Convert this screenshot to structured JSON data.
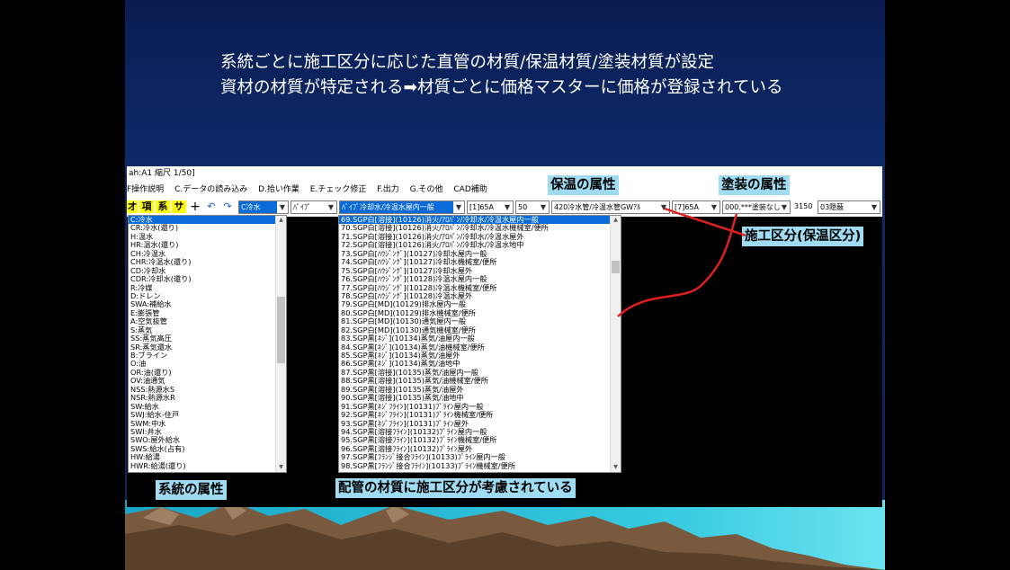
{
  "slide": {
    "title_line1": "系統ごとに施工区分に応じた直管の材質/保温材質/塗装材質が設定",
    "title_line2": "資材の材質が特定される➡材質ごとに価格マスターに価格が登録されている"
  },
  "window": {
    "title": "ah:A1 縮尺 1/50]",
    "menus": [
      "F操作説明",
      "C.データの読み込み",
      "D.拾い作業",
      "E.チェック修正",
      "F.出力",
      "G.その他",
      "CAD補助"
    ]
  },
  "toolbar": {
    "btn_zai": "オ",
    "btn_kou": "項",
    "btn_kei": "系",
    "btn_sa": "サ",
    "btn_plus": "+",
    "btn_undo": "↶",
    "btn_redo": "↷",
    "combo_system": "C冷水",
    "combo_type": "ﾊﾟｲﾌﾟ",
    "combo_material": "ﾊﾟｲﾌﾟ冷却水/冷温水屋内一般",
    "combo_size": "[1]65A",
    "combo_num": "50",
    "combo_insulation": "420冷水管/冷温水管GWｱﾙ",
    "combo_size2": "[7]65A",
    "combo_paint": "000.***塗装なし",
    "price": "3150",
    "combo_hidden": "03隠蔽"
  },
  "system_list": [
    "C:冷水",
    "CR:冷水(還り)",
    "H:温水",
    "HR:温水(還り)",
    "CH:冷温水",
    "CHR:冷温水(還り)",
    "CD:冷却水",
    "CDR:冷却水(還り)",
    "R:冷媒",
    "D:ドレン",
    "SWA:補給水",
    "E:膨張管",
    "A:空気抜管",
    "S:蒸気",
    "SS:蒸気高圧",
    "SR:蒸気還水",
    "B:ブライン",
    "O:油",
    "OR:油(還り)",
    "OV:油通気",
    "NSS:熱源水S",
    "NSR:熱源水R",
    "SW:給水",
    "SWJ:給水-住戸",
    "SWM:中水",
    "SWI:井水",
    "SWO:屋外給水",
    "SWS:給水(占有)",
    "HW:給湯",
    "HWR:給湯(還り)"
  ],
  "material_list": [
    "69.SGP白[溶接](10126)消火/ｱﾛﾊﾟﾝ/冷却水/冷温水屋内一般",
    "70.SGP白[溶接](10126)消火/ｱﾛﾊﾟﾝ/冷却水/冷温水機械室/便所",
    "71.SGP白[溶接](10126)消火/ｱﾛﾊﾟﾝ/冷却水/冷温水屋外",
    "72.SGP白[溶接](10126)消火/ｱﾛﾊﾟﾝ/冷却水/冷温水地中",
    "73.SGP白[ﾊｳｼﾞﾝｸﾞ](10127)冷却水屋内一般",
    "74.SGP白[ﾊｳｼﾞﾝｸﾞ](10127)冷却水機械室/便所",
    "75.SGP白[ﾊｳｼﾞﾝｸﾞ](10127)冷却水屋外",
    "76.SGP白[ﾊｳｼﾞﾝｸﾞ](10128)冷温水屋内一般",
    "77.SGP白[ﾊｳｼﾞﾝｸﾞ](10128)冷温水機械室/便所",
    "78.SGP白[ﾊｳｼﾞﾝｸﾞ](10128)冷温水屋外",
    "79.SGP白[MD](10129)排水屋内一般",
    "80.SGP白[MD](10129)排水機械室/便所",
    "81.SGP白[MD](10130)通気屋内一般",
    "82.SGP白[MD](10130)通気機械室/便所",
    "83.SGP黒[ﾈｼﾞ](10134)蒸気/油屋内一般",
    "84.SGP黒[ﾈｼﾞ](10134)蒸気/油機械室/便所",
    "85.SGP黒[ﾈｼﾞ](10134)蒸気/油屋外",
    "86.SGP黒[ﾈｼﾞ](10134)蒸気/油地中",
    "87.SGP黒[溶接](10135)蒸気/油屋内一般",
    "88.SGP黒[溶接](10135)蒸気/油機械室/便所",
    "89.SGP黒[溶接](10135)蒸気/油屋外",
    "90.SGP黒[溶接](10135)蒸気/油地中",
    "91.SGP黒[ﾈｼﾞﾌﾗｲﾝ](10131)ﾌﾞﾗｲﾝ屋内一般",
    "92.SGP黒[ﾈｼﾞﾌﾗｲﾝ](10131)ﾌﾞﾗｲﾝ機械室/便所",
    "93.SGP黒[ﾈｼﾞﾌﾗｲﾝ](10131)ﾌﾞﾗｲﾝ屋外",
    "94.SGP黒[溶接ﾌﾗｲﾝ](10132)ﾌﾞﾗｲﾝ屋内一般",
    "95.SGP黒[溶接ﾌﾗｲﾝ](10132)ﾌﾞﾗｲﾝ機械室/便所",
    "96.SGP黒[溶接ﾌﾗｲﾝ](10132)ﾌﾞﾗｲﾝ屋外",
    "97.SGP黒[ﾌﾗﾝｼﾞ接合ﾌﾗｲﾝ](10133)ﾌﾞﾗｲﾝ屋内一般",
    "98.SGP黒[ﾌﾗﾝｼﾞ接合ﾌﾗｲﾝ](10133)ﾌﾞﾗｲﾝ機械室/便所"
  ],
  "labels": {
    "insulation_attr": "保温の属性",
    "paint_attr": "塗装の属性",
    "work_division": "施工区分(保温区分)",
    "system_attr": "系統の属性",
    "pipe_material": "配管の材質に施工区分が考慮されている"
  }
}
